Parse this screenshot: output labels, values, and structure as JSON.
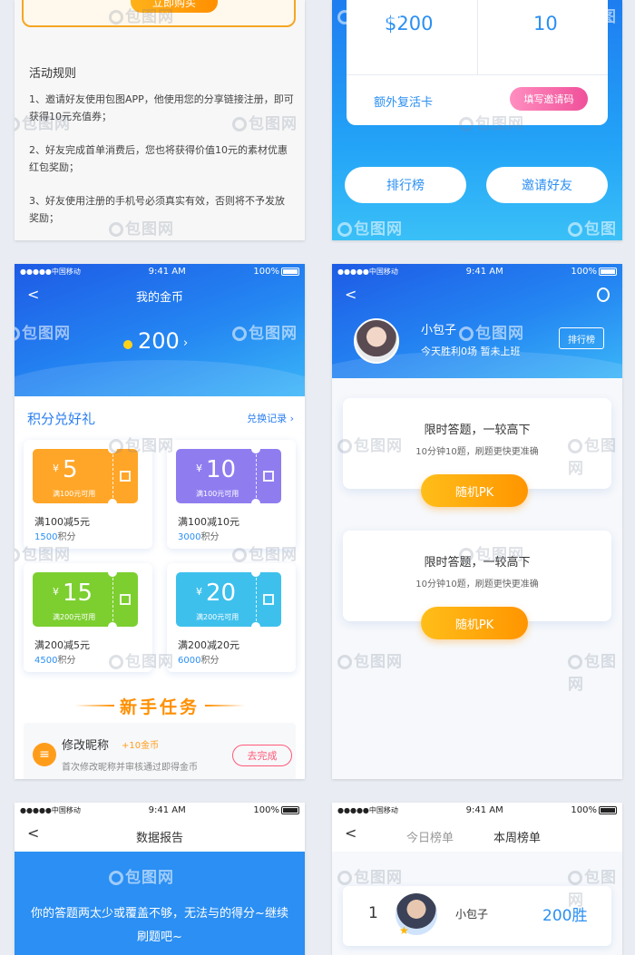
{
  "status": {
    "carrier": "●●●●●中国移动",
    "time": "9:41 AM",
    "battery": "100%"
  },
  "watermark": "包图网",
  "panel1": {
    "buy_button": "立即购买",
    "rules_title": "活动规则",
    "rules": [
      "1、邀请好友使用包图APP，他使用您的分享链接注册，即可获得10元充值券；",
      "2、好友完成首单消费后，您也将获得价值10元的素材优惠红包奖励；",
      "3、好友使用注册的手机号必须真实有效，否则将不予发放奖励；"
    ]
  },
  "panel2": {
    "money": "$200",
    "count": "10",
    "extra_card": "额外复活卡",
    "invite_code_button": "填写邀请码",
    "leaderboard_button": "排行榜",
    "invite_friends_button": "邀请好友"
  },
  "panel3": {
    "title": "我的金币",
    "coins": "200",
    "section_title": "积分兑好礼",
    "exchange_link": "兑换记录 ›",
    "coupons": [
      {
        "amount": "5",
        "condition": "满100元可用",
        "name": "满100减5元",
        "points": "1500",
        "points_unit": "积分",
        "color": "#ffa628"
      },
      {
        "amount": "10",
        "condition": "满100元可用",
        "name": "满100减10元",
        "points": "3000",
        "points_unit": "积分",
        "color": "#8f7df0"
      },
      {
        "amount": "15",
        "condition": "满200元可用",
        "name": "满200减5元",
        "points": "4500",
        "points_unit": "积分",
        "color": "#7ccf2f"
      },
      {
        "amount": "20",
        "condition": "满200元可用",
        "name": "满200减20元",
        "points": "6000",
        "points_unit": "积分",
        "color": "#3ec0ec"
      }
    ],
    "currency": "¥",
    "task_header": "新手任务",
    "task": {
      "icon": "≡",
      "name": "修改昵称",
      "reward": "+10金币",
      "desc": "首次修改昵称并审核通过即得金币",
      "button": "去完成"
    }
  },
  "panel4": {
    "username": "小包子",
    "stats": "今天胜利0场   暂未上班",
    "rank_button": "排行榜",
    "cards": [
      {
        "title": "限时答题，一较高下",
        "sub": "10分钟10题，刷题更快更准确",
        "button": "随机PK"
      },
      {
        "title": "限时答题，一较高下",
        "sub": "10分钟10题，刷题更快更准确",
        "button": "随机PK"
      }
    ]
  },
  "panel5": {
    "title": "数据报告",
    "message": "你的答题两太少或覆盖不够，无法与的得分~继续刷题吧~"
  },
  "panel6": {
    "tab_today": "今日榜单",
    "tab_week": "本周榜单",
    "rank": {
      "position": "1",
      "name": "小包子",
      "score": "200胜"
    }
  }
}
